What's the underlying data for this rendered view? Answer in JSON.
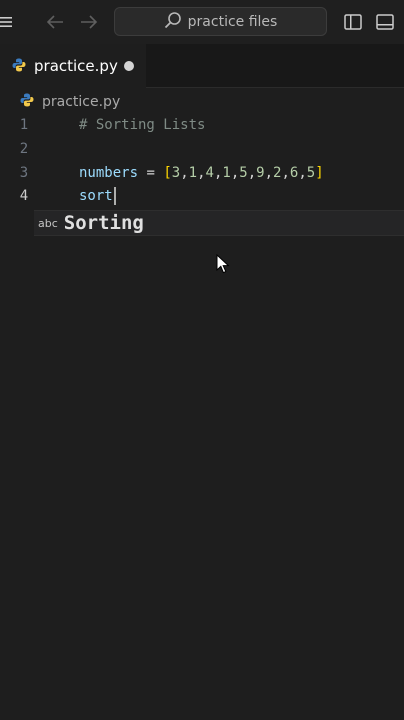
{
  "titlebar": {
    "search_text": "practice files",
    "icons": [
      "menu-icon",
      "back-arrow-icon",
      "forward-arrow-icon",
      "search-icon",
      "toggle-sidebar-icon",
      "toggle-panel-icon"
    ]
  },
  "tab": {
    "label": "practice.py",
    "dirty": true
  },
  "breadcrumb": {
    "file": "practice.py"
  },
  "editor": {
    "lines": [
      {
        "number": "1",
        "text": "# Sorting Lists"
      },
      {
        "number": "2",
        "text": ""
      },
      {
        "number": "3",
        "text": "numbers = [3,1,4,1,5,9,2,6,5]"
      },
      {
        "number": "4",
        "text": "sort"
      }
    ],
    "active_line": "4"
  },
  "suggestion": {
    "kind": "abc",
    "label": "Sorting"
  },
  "colors": {
    "background": "#1e1e1e",
    "python_blue": "#3b7bbf",
    "python_yellow": "#f2c94c"
  }
}
